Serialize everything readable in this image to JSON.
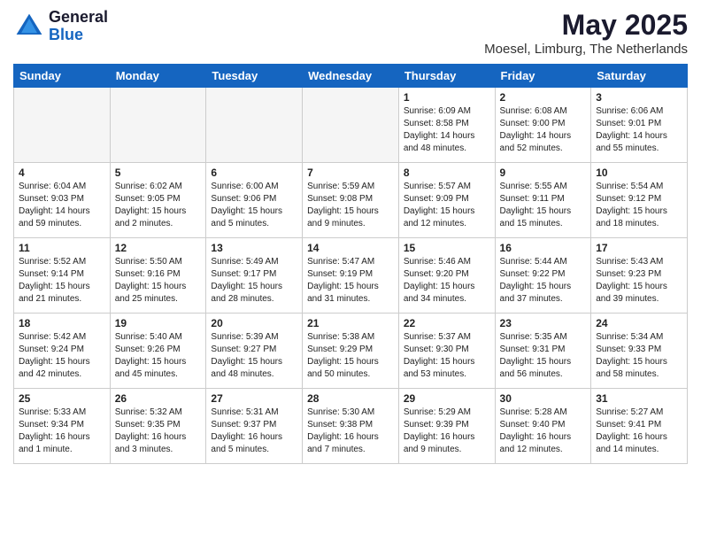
{
  "header": {
    "logo_general": "General",
    "logo_blue": "Blue",
    "month_title": "May 2025",
    "location": "Moesel, Limburg, The Netherlands"
  },
  "weekdays": [
    "Sunday",
    "Monday",
    "Tuesday",
    "Wednesday",
    "Thursday",
    "Friday",
    "Saturday"
  ],
  "weeks": [
    [
      {
        "day": "",
        "info": ""
      },
      {
        "day": "",
        "info": ""
      },
      {
        "day": "",
        "info": ""
      },
      {
        "day": "",
        "info": ""
      },
      {
        "day": "1",
        "info": "Sunrise: 6:09 AM\nSunset: 8:58 PM\nDaylight: 14 hours\nand 48 minutes."
      },
      {
        "day": "2",
        "info": "Sunrise: 6:08 AM\nSunset: 9:00 PM\nDaylight: 14 hours\nand 52 minutes."
      },
      {
        "day": "3",
        "info": "Sunrise: 6:06 AM\nSunset: 9:01 PM\nDaylight: 14 hours\nand 55 minutes."
      }
    ],
    [
      {
        "day": "4",
        "info": "Sunrise: 6:04 AM\nSunset: 9:03 PM\nDaylight: 14 hours\nand 59 minutes."
      },
      {
        "day": "5",
        "info": "Sunrise: 6:02 AM\nSunset: 9:05 PM\nDaylight: 15 hours\nand 2 minutes."
      },
      {
        "day": "6",
        "info": "Sunrise: 6:00 AM\nSunset: 9:06 PM\nDaylight: 15 hours\nand 5 minutes."
      },
      {
        "day": "7",
        "info": "Sunrise: 5:59 AM\nSunset: 9:08 PM\nDaylight: 15 hours\nand 9 minutes."
      },
      {
        "day": "8",
        "info": "Sunrise: 5:57 AM\nSunset: 9:09 PM\nDaylight: 15 hours\nand 12 minutes."
      },
      {
        "day": "9",
        "info": "Sunrise: 5:55 AM\nSunset: 9:11 PM\nDaylight: 15 hours\nand 15 minutes."
      },
      {
        "day": "10",
        "info": "Sunrise: 5:54 AM\nSunset: 9:12 PM\nDaylight: 15 hours\nand 18 minutes."
      }
    ],
    [
      {
        "day": "11",
        "info": "Sunrise: 5:52 AM\nSunset: 9:14 PM\nDaylight: 15 hours\nand 21 minutes."
      },
      {
        "day": "12",
        "info": "Sunrise: 5:50 AM\nSunset: 9:16 PM\nDaylight: 15 hours\nand 25 minutes."
      },
      {
        "day": "13",
        "info": "Sunrise: 5:49 AM\nSunset: 9:17 PM\nDaylight: 15 hours\nand 28 minutes."
      },
      {
        "day": "14",
        "info": "Sunrise: 5:47 AM\nSunset: 9:19 PM\nDaylight: 15 hours\nand 31 minutes."
      },
      {
        "day": "15",
        "info": "Sunrise: 5:46 AM\nSunset: 9:20 PM\nDaylight: 15 hours\nand 34 minutes."
      },
      {
        "day": "16",
        "info": "Sunrise: 5:44 AM\nSunset: 9:22 PM\nDaylight: 15 hours\nand 37 minutes."
      },
      {
        "day": "17",
        "info": "Sunrise: 5:43 AM\nSunset: 9:23 PM\nDaylight: 15 hours\nand 39 minutes."
      }
    ],
    [
      {
        "day": "18",
        "info": "Sunrise: 5:42 AM\nSunset: 9:24 PM\nDaylight: 15 hours\nand 42 minutes."
      },
      {
        "day": "19",
        "info": "Sunrise: 5:40 AM\nSunset: 9:26 PM\nDaylight: 15 hours\nand 45 minutes."
      },
      {
        "day": "20",
        "info": "Sunrise: 5:39 AM\nSunset: 9:27 PM\nDaylight: 15 hours\nand 48 minutes."
      },
      {
        "day": "21",
        "info": "Sunrise: 5:38 AM\nSunset: 9:29 PM\nDaylight: 15 hours\nand 50 minutes."
      },
      {
        "day": "22",
        "info": "Sunrise: 5:37 AM\nSunset: 9:30 PM\nDaylight: 15 hours\nand 53 minutes."
      },
      {
        "day": "23",
        "info": "Sunrise: 5:35 AM\nSunset: 9:31 PM\nDaylight: 15 hours\nand 56 minutes."
      },
      {
        "day": "24",
        "info": "Sunrise: 5:34 AM\nSunset: 9:33 PM\nDaylight: 15 hours\nand 58 minutes."
      }
    ],
    [
      {
        "day": "25",
        "info": "Sunrise: 5:33 AM\nSunset: 9:34 PM\nDaylight: 16 hours\nand 1 minute."
      },
      {
        "day": "26",
        "info": "Sunrise: 5:32 AM\nSunset: 9:35 PM\nDaylight: 16 hours\nand 3 minutes."
      },
      {
        "day": "27",
        "info": "Sunrise: 5:31 AM\nSunset: 9:37 PM\nDaylight: 16 hours\nand 5 minutes."
      },
      {
        "day": "28",
        "info": "Sunrise: 5:30 AM\nSunset: 9:38 PM\nDaylight: 16 hours\nand 7 minutes."
      },
      {
        "day": "29",
        "info": "Sunrise: 5:29 AM\nSunset: 9:39 PM\nDaylight: 16 hours\nand 9 minutes."
      },
      {
        "day": "30",
        "info": "Sunrise: 5:28 AM\nSunset: 9:40 PM\nDaylight: 16 hours\nand 12 minutes."
      },
      {
        "day": "31",
        "info": "Sunrise: 5:27 AM\nSunset: 9:41 PM\nDaylight: 16 hours\nand 14 minutes."
      }
    ]
  ]
}
